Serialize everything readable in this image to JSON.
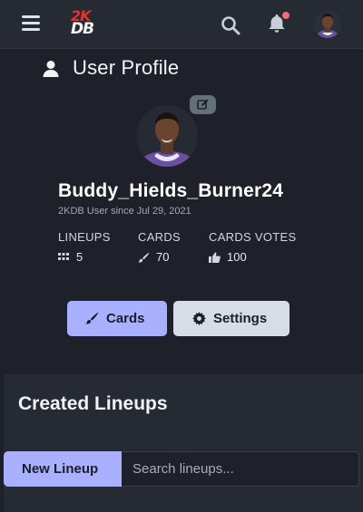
{
  "navbar": {
    "logo_top": "2K",
    "logo_bottom": "DB",
    "icons": [
      "menu-icon",
      "search-icon",
      "bell-icon"
    ],
    "notification_dot_color": "#f26b7a"
  },
  "header": {
    "title": "User Profile"
  },
  "profile": {
    "username": "Buddy_Hields_Burner24",
    "member_since": "2KDB User since Jul 29, 2021",
    "stats": [
      {
        "label": "LINEUPS",
        "value": "5",
        "icon": "grid-icon"
      },
      {
        "label": "CARDS",
        "value": "70",
        "icon": "brush-icon"
      },
      {
        "label": "CARDS VOTES",
        "value": "100",
        "icon": "thumbs-up-icon"
      }
    ]
  },
  "actions": {
    "cards_label": "Cards",
    "settings_label": "Settings"
  },
  "lineups": {
    "title": "Created Lineups",
    "new_label": "New Lineup",
    "search_placeholder": "Search lineups..."
  },
  "colors": {
    "background": "#1e2129",
    "panel": "#262a33",
    "accent": "#a9b1ff",
    "secondary_button": "#d7dce5",
    "logo_red": "#e5322d"
  }
}
